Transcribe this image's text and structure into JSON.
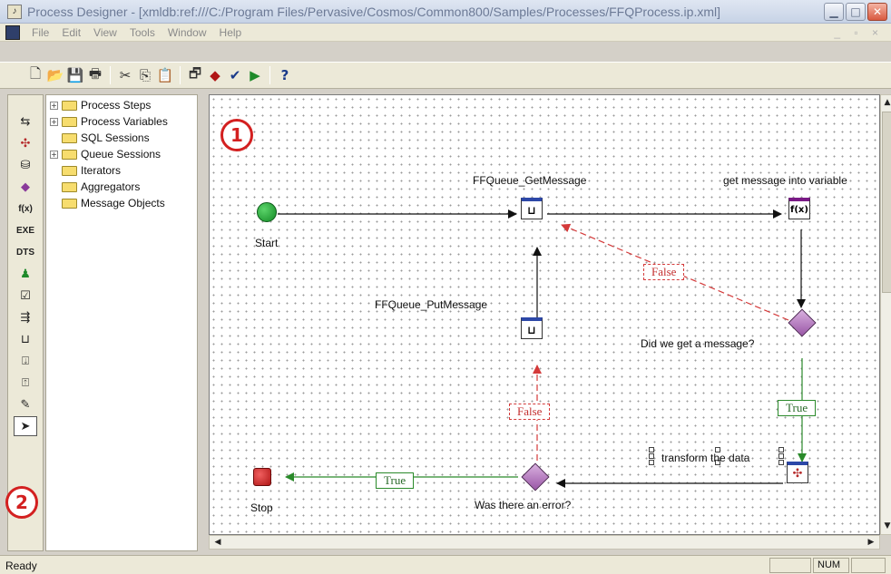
{
  "window": {
    "title": "Process Designer - [xmldb:ref:///C:/Program Files/Pervasive/Cosmos/Common800/Samples/Processes/FFQProcess.ip.xml]",
    "app_icon": "process-designer-icon",
    "controls": [
      "minimize",
      "maximize",
      "close"
    ]
  },
  "menu": {
    "items": [
      "File",
      "Edit",
      "View",
      "Tools",
      "Window",
      "Help"
    ]
  },
  "toolbar": {
    "buttons": [
      "new-icon",
      "open-icon",
      "save-icon",
      "print-icon",
      "cut-icon",
      "copy-icon",
      "paste-icon",
      "properties-icon",
      "validate-icon",
      "check-icon",
      "run-icon",
      "help-icon"
    ]
  },
  "palette": {
    "tools": [
      "step-icon",
      "transform-icon",
      "database-icon",
      "decision-icon",
      "function-icon",
      "EXE",
      "DTS",
      "user-icon",
      "checklist-icon",
      "iterator-icon",
      "queue-icon",
      "put-message-icon",
      "get-message-icon",
      "edit-icon",
      "pointer-icon"
    ]
  },
  "tree": {
    "items": [
      {
        "label": "Process Steps",
        "expandable": true
      },
      {
        "label": "Process Variables",
        "expandable": true
      },
      {
        "label": "SQL Sessions",
        "expandable": false
      },
      {
        "label": "Queue Sessions",
        "expandable": true
      },
      {
        "label": "Iterators",
        "expandable": false
      },
      {
        "label": "Aggregators",
        "expandable": false
      },
      {
        "label": "Message Objects",
        "expandable": false
      }
    ]
  },
  "diagram": {
    "labels": {
      "start": "Start",
      "getmsg": "FFQueue_GetMessage",
      "func": "get message into variable",
      "putmsg": "FFQueue_PutMessage",
      "decision1": "Did we get a message?",
      "transform": "transform the data",
      "decision2": "Was there an error?",
      "stop": "Stop"
    },
    "edge_labels": {
      "false1": "False",
      "true1": "True",
      "false2": "False",
      "true2": "True"
    },
    "colors": {
      "true_edge": "#2a8a2a",
      "false_edge": "#d43a3a",
      "flow_edge": "#111111"
    }
  },
  "callouts": {
    "one": "1",
    "two": "2"
  },
  "status": {
    "text": "Ready",
    "num": "NUM"
  }
}
